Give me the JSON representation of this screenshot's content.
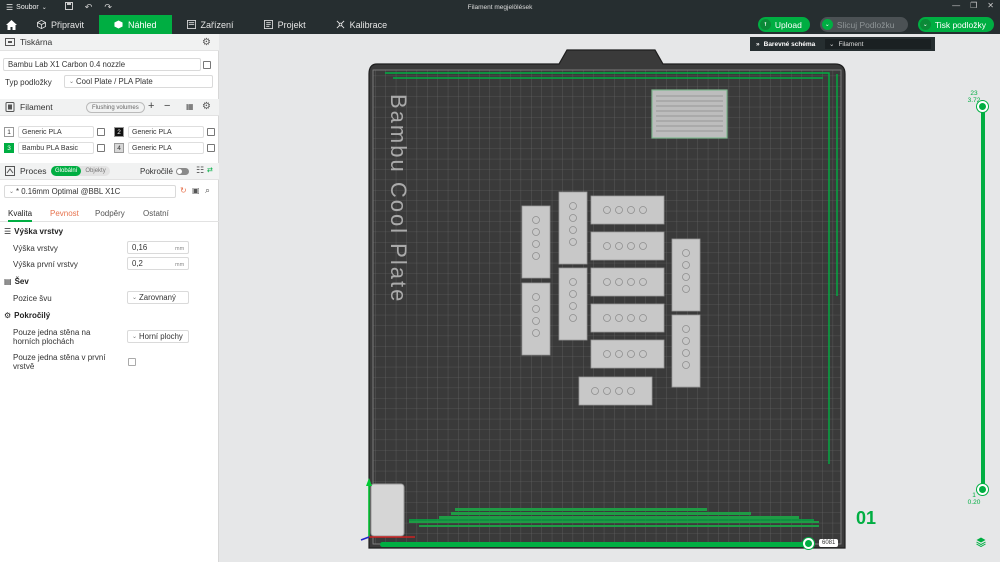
{
  "app": {
    "menu_label": "Soubor",
    "window_title": "Filament megjelölések"
  },
  "nav": {
    "tabs": [
      {
        "label": "Připravit",
        "icon": "cube-icon"
      },
      {
        "label": "Náhled",
        "icon": "preview-icon",
        "active": true
      },
      {
        "label": "Zařízení",
        "icon": "device-icon"
      },
      {
        "label": "Projekt",
        "icon": "project-icon"
      },
      {
        "label": "Kalibrace",
        "icon": "calibration-icon"
      }
    ],
    "upload_label": "Upload",
    "slice_label": "Slicuj Podložku",
    "print_label": "Tisk podložky"
  },
  "printer": {
    "section_title": "Tiskárna",
    "printer_name": "Bambu Lab X1 Carbon 0.4 nozzle",
    "plate_type_label": "Typ podložky",
    "plate_type_value": "Cool Plate / PLA Plate"
  },
  "filament": {
    "section_title": "Filament",
    "flushing_label": "Flushing volumes",
    "items": [
      {
        "num": "1",
        "name": "Generic PLA",
        "color": "#ffffff"
      },
      {
        "num": "2",
        "name": "Generic PLA",
        "color": "#111111"
      },
      {
        "num": "3",
        "name": "Bambu PLA Basic",
        "color": "#00ae42"
      },
      {
        "num": "4",
        "name": "Generic PLA",
        "color": "#d8d8d8"
      }
    ]
  },
  "process": {
    "section_title": "Proces",
    "global_label": "Globální",
    "objects_label": "Objekty",
    "advanced_label": "Pokročilé",
    "profile": "* 0.16mm Optimal @BBL X1C",
    "tabs": [
      "Kvalita",
      "Pevnost",
      "Podpěry",
      "Ostatní"
    ],
    "groups": {
      "layer_height": "Výška vrstvy",
      "seam": "Šev",
      "advanced": "Pokročilý"
    },
    "settings": {
      "layer_height_label": "Výška vrstvy",
      "layer_height_value": "0,16",
      "first_layer_label": "Výška první vrstvy",
      "first_layer_value": "0,2",
      "unit": "mm",
      "seam_pos_label": "Pozice švu",
      "seam_pos_value": "Zarovnaný",
      "single_wall_top_label_1": "Pouze jedna stěna na",
      "single_wall_top_label_2": "horních plochách",
      "single_wall_top_value": "Horní plochy",
      "single_wall_first_label_1": "Pouze jedna stěna v první",
      "single_wall_first_label_2": "vrstvě"
    }
  },
  "viewport": {
    "legend_title": "Barevné schéma",
    "legend_value": "Filament",
    "plate_text": "Bambu Cool Plate",
    "plate_number": "01",
    "layer_top_index": "23",
    "layer_top_height": "3.72",
    "layer_bottom_index": "1",
    "layer_bottom_height": "0.20",
    "move_value": "6081"
  },
  "colors": {
    "accent": "#00ae42",
    "dark_bar": "#262e30",
    "plate": "#3a3a3a"
  }
}
